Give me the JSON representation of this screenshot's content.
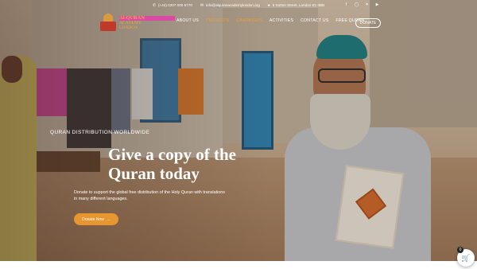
{
  "topbar": {
    "phone": "(+44) 0207 000 6770",
    "email": "info@alquranacademylondon.org",
    "address": "5 Sutton Street, London E1 0BB",
    "phone_icon": "phone-icon",
    "email_icon": "mail-icon",
    "address_icon": "map-pin-icon"
  },
  "socials": [
    "facebook-icon",
    "instagram-icon",
    "x-icon",
    "youtube-icon"
  ],
  "logo": {
    "line1": "Al-QURAN",
    "line2": "ACADEMY",
    "line3": "LONDON"
  },
  "nav": {
    "items": [
      "ABOUT US",
      "PROJECTS",
      "CAMPAIGNS",
      "ACTIVITIES",
      "CONTACT US",
      "FREE QURAN"
    ],
    "donate": "DONATE",
    "accent": "#ef9c3b"
  },
  "hero": {
    "tagline": "QURAN DISTRIBUTION WORLDWIDE",
    "headline": "Give a copy of the Quran today",
    "description": "Donate to support the global free distribution of the Holy Quran with translations in many different languages.",
    "cta": "Donate Now",
    "cta_icon": "arrow-right-icon",
    "cta_color": "#e8962f"
  },
  "cart": {
    "count": "0",
    "icon": "basket-icon"
  }
}
